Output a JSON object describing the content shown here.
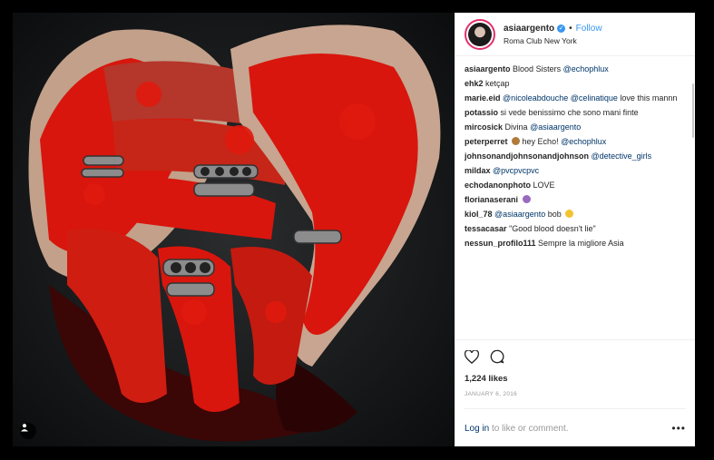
{
  "post": {
    "username": "asiaargento",
    "follow_label": "Follow",
    "location": "Roma Club New York",
    "likes": "1,224 likes",
    "date": "JANUARY 6, 2016",
    "login_link": "Log in",
    "login_rest": " to like or comment.",
    "more_label": "•••"
  },
  "comments": [
    {
      "user": "asiaargento",
      "text": "Blood Sisters ",
      "mention": "@echophlux"
    },
    {
      "user": "ehk2",
      "text": "ketçap"
    },
    {
      "user": "marie.eid",
      "mention": "@nicoleabdouche @celinatique",
      "after": " love this mannn"
    },
    {
      "user": "potassio",
      "text": "si vede benissimo che sono mani finte"
    },
    {
      "user": "mircosick",
      "text": "Divina ",
      "mention": "@asiaargento"
    },
    {
      "user": "peterperret",
      "text": " hey Echo! ",
      "mention": "@echophlux"
    },
    {
      "user": "johnsonandjohnsonandjohnson",
      "mention": "@detective_girls"
    },
    {
      "user": "mildax",
      "mention": "@pvcpvcpvc"
    },
    {
      "user": "echodanonphoto",
      "text": "LOVE"
    },
    {
      "user": "florianaserani",
      "text": ""
    },
    {
      "user": "kiol_78",
      "mention": "@asiaargento",
      "after": " bob "
    },
    {
      "user": "tessacasar",
      "text": "\"Good blood doesn't lie\""
    },
    {
      "user": "nessun_profilo111",
      "text": "Sempre la migliore Asia"
    }
  ],
  "colors": {
    "link": "#3897f0",
    "mention": "#003569",
    "blood": "#d8160d"
  },
  "icons": [
    "heart-icon",
    "comment-icon",
    "person-tag-icon",
    "verified-icon"
  ]
}
